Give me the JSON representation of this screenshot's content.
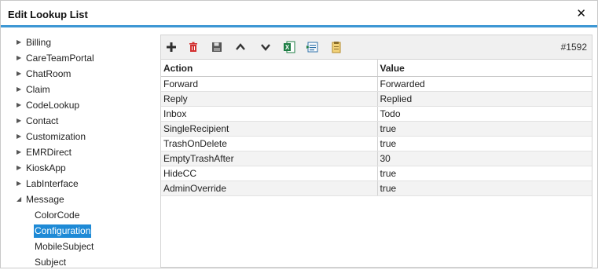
{
  "dialog": {
    "title": "Edit Lookup List",
    "close_glyph": "✕"
  },
  "tree": {
    "items": [
      {
        "label": "Billing",
        "expanded": false
      },
      {
        "label": "CareTeamPortal",
        "expanded": false
      },
      {
        "label": "ChatRoom",
        "expanded": false
      },
      {
        "label": "Claim",
        "expanded": false
      },
      {
        "label": "CodeLookup",
        "expanded": false
      },
      {
        "label": "Contact",
        "expanded": false
      },
      {
        "label": "Customization",
        "expanded": false
      },
      {
        "label": "EMRDirect",
        "expanded": false
      },
      {
        "label": "KioskApp",
        "expanded": false
      },
      {
        "label": "LabInterface",
        "expanded": false
      },
      {
        "label": "Message",
        "expanded": true
      }
    ],
    "message_children": [
      {
        "label": "ColorCode",
        "selected": false
      },
      {
        "label": "Configuration",
        "selected": true
      },
      {
        "label": "MobileSubject",
        "selected": false
      },
      {
        "label": "Subject",
        "selected": false
      }
    ]
  },
  "toolbar": {
    "buttons": [
      "add-icon",
      "delete-icon",
      "save-icon",
      "move-up-icon",
      "move-down-icon",
      "excel-export-icon",
      "import-icon",
      "report-icon"
    ],
    "record_id": "#1592"
  },
  "grid": {
    "columns": [
      "Action",
      "Value"
    ],
    "rows": [
      [
        "Forward",
        "Forwarded"
      ],
      [
        "Reply",
        "Replied"
      ],
      [
        "Inbox",
        "Todo"
      ],
      [
        "SingleRecipient",
        "true"
      ],
      [
        "TrashOnDelete",
        "true"
      ],
      [
        "EmptyTrashAfter",
        "30"
      ],
      [
        "HideCC",
        "true"
      ],
      [
        "AdminOverride",
        "true"
      ]
    ]
  },
  "colors": {
    "accent": "#3d97d4",
    "selection": "#1e8ad6",
    "add": "#2e2e2e",
    "delete": "#d32f2f",
    "excel": "#1e7e45"
  }
}
